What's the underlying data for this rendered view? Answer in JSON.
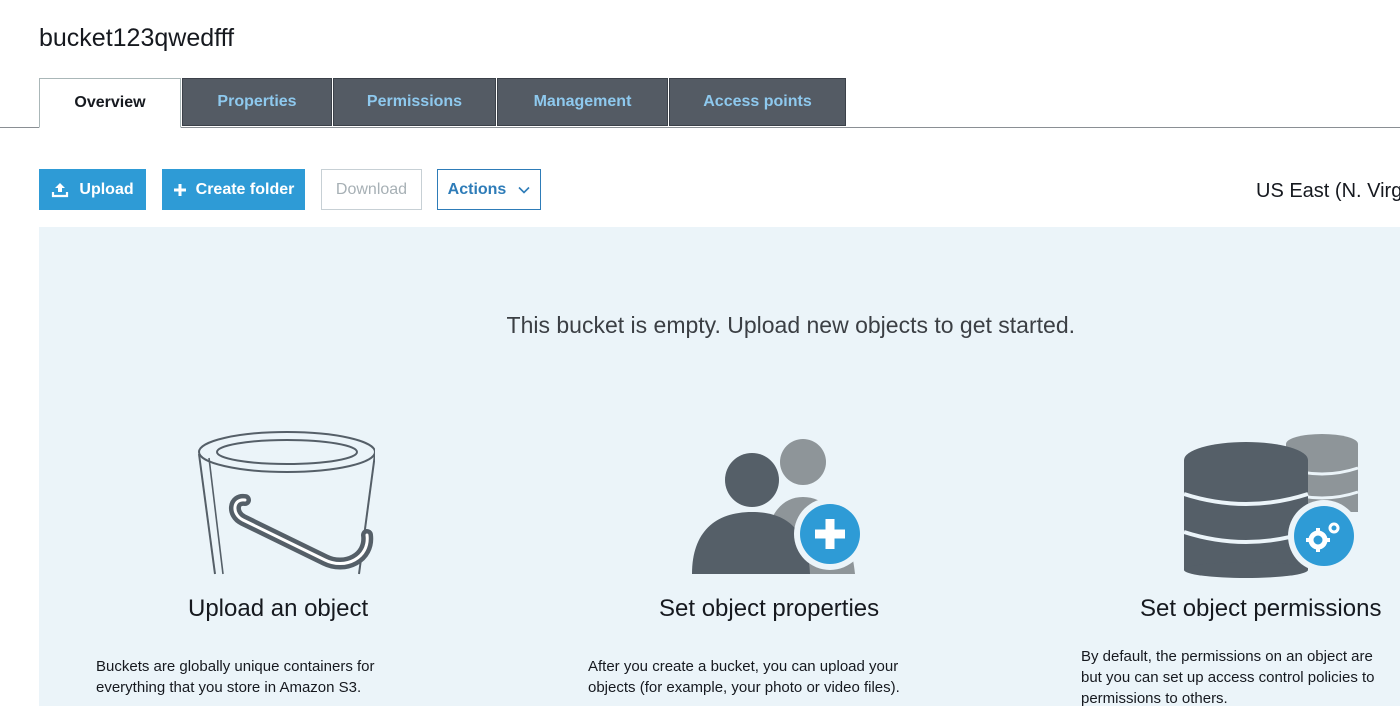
{
  "header": {
    "bucket_name": "bucket123qwedfff"
  },
  "tabs": [
    {
      "label": "Overview",
      "active": true
    },
    {
      "label": "Properties",
      "active": false
    },
    {
      "label": "Permissions",
      "active": false
    },
    {
      "label": "Management",
      "active": false
    },
    {
      "label": "Access points",
      "active": false
    }
  ],
  "toolbar": {
    "upload_label": "Upload",
    "create_folder_label": "Create folder",
    "download_label": "Download",
    "actions_label": "Actions"
  },
  "region": "US East (N. Virg",
  "empty_state": {
    "message": "This bucket is empty. Upload new objects to get started.",
    "cards": [
      {
        "icon": "bucket-icon",
        "title": "Upload an object",
        "desc_lines": [
          "Buckets are globally unique containers for",
          "everything that you store in Amazon S3."
        ]
      },
      {
        "icon": "users-add-icon",
        "title": "Set object properties",
        "desc_lines": [
          "After you create a bucket, you can upload your",
          "objects (for example, your photo or video files)."
        ]
      },
      {
        "icon": "database-settings-icon",
        "title": "Set object permissions",
        "desc_lines": [
          "By default, the permissions on an object are",
          "but you can set up access control policies to",
          "permissions to others."
        ]
      }
    ]
  },
  "colors": {
    "primary": "#2e9bd6",
    "tab_dark": "#545b64",
    "tab_text": "#8ec9ee",
    "panel_bg": "#ebf4f9",
    "icon_gray": "#555f68"
  }
}
